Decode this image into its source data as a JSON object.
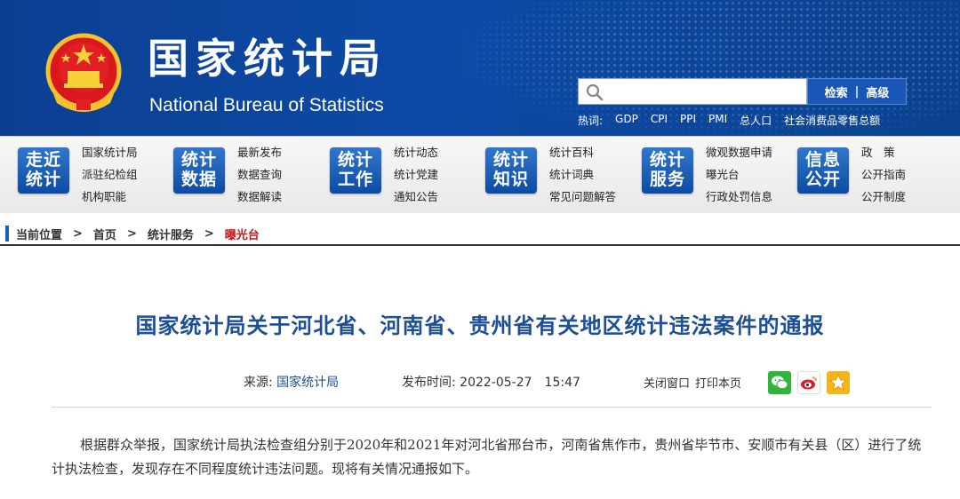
{
  "header": {
    "title_cn": "国家统计局",
    "title_en": "National Bureau of Statistics",
    "search": {
      "placeholder": "",
      "btn_search": "检索",
      "btn_advanced": "高级"
    },
    "hot_label": "热词:",
    "hot_words": [
      "GDP",
      "CPI",
      "PPI",
      "PMI",
      "总人口",
      "社会消费品零售总额"
    ]
  },
  "nav": [
    {
      "badge": [
        "走近",
        "统计"
      ],
      "links": [
        "国家统计局",
        "派驻纪检组",
        "机构职能"
      ]
    },
    {
      "badge": [
        "统计",
        "数据"
      ],
      "links": [
        "最新发布",
        "数据查询",
        "数据解读"
      ]
    },
    {
      "badge": [
        "统计",
        "工作"
      ],
      "links": [
        "统计动态",
        "统计党建",
        "通知公告"
      ]
    },
    {
      "badge": [
        "统计",
        "知识"
      ],
      "links": [
        "统计百科",
        "统计词典",
        "常见问题解答"
      ]
    },
    {
      "badge": [
        "统计",
        "服务"
      ],
      "links": [
        "微观数据申请",
        "曝光台",
        "行政处罚信息"
      ]
    },
    {
      "badge": [
        "信息",
        "公开"
      ],
      "links": [
        "政　策",
        "公开指南",
        "公开制度"
      ]
    }
  ],
  "breadcrumb": {
    "label": "当前位置",
    "items": [
      "首页",
      "统计服务",
      "曝光台"
    ],
    "sep": ">"
  },
  "article": {
    "title": "国家统计局关于河北省、河南省、贵州省有关地区统计违法案件的通报",
    "source_label": "来源:",
    "source": "国家统计局",
    "time_label": "发布时间:",
    "time": "2022-05-27　15:47",
    "close_btn": "关闭窗口",
    "print_btn": "打印本页",
    "body": "根据群众举报，国家统计局执法检查组分别于2020年和2021年对河北省邢台市，河南省焦作市，贵州省毕节市、安顺市有关县（区）进行了统计执法检查，发现存在不同程度统计违法问题。现将有关情况通报如下。"
  },
  "colors": {
    "header_bg": "#0d4aa6",
    "title_blue": "#1c4f93",
    "current_red": "#c8161d",
    "badge_blue": "#1a5fb4"
  }
}
